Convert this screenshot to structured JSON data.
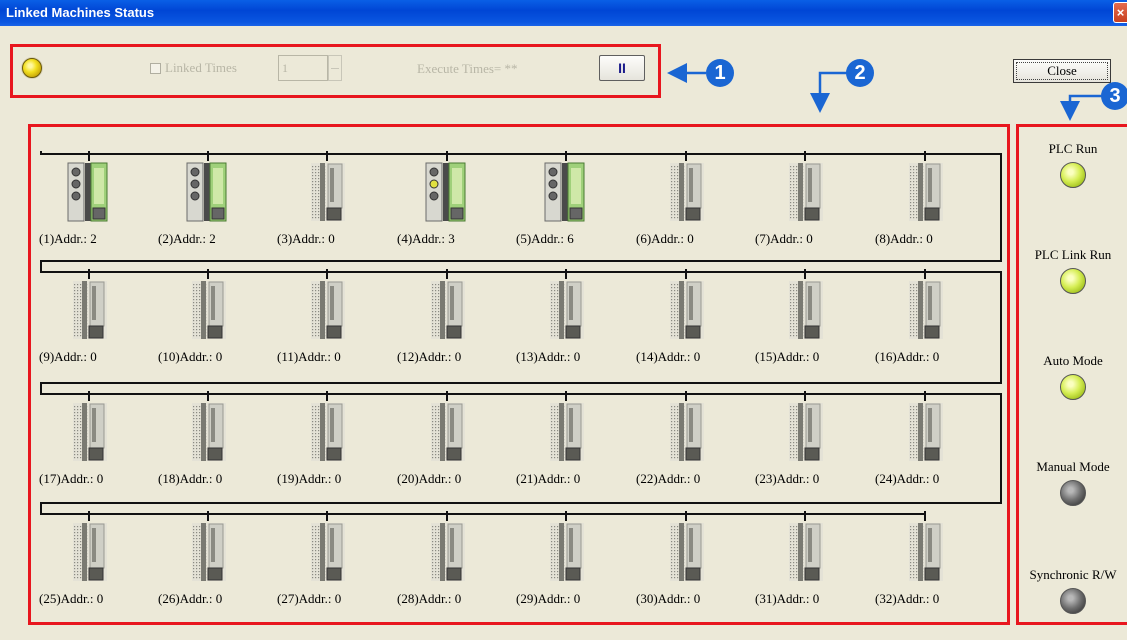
{
  "window": {
    "title": "Linked Machines Status",
    "close_glyph": "×"
  },
  "toolbar": {
    "linked_times_label": "Linked Times",
    "linked_times_value": "1",
    "execute_times_label": "Execute Times= **",
    "pause_label": "II",
    "close_label": "Close"
  },
  "callouts": [
    "1",
    "2",
    "3"
  ],
  "machines": [
    {
      "label": "(1)Addr.: 2",
      "active": true,
      "led": "gray"
    },
    {
      "label": "(2)Addr.: 2",
      "active": true,
      "led": "gray"
    },
    {
      "label": "(3)Addr.: 0",
      "active": false
    },
    {
      "label": "(4)Addr.: 3",
      "active": true,
      "led": "yellow"
    },
    {
      "label": "(5)Addr.: 6",
      "active": true,
      "led": "gray"
    },
    {
      "label": "(6)Addr.: 0",
      "active": false
    },
    {
      "label": "(7)Addr.: 0",
      "active": false
    },
    {
      "label": "(8)Addr.: 0",
      "active": false
    },
    {
      "label": "(9)Addr.: 0",
      "active": false
    },
    {
      "label": "(10)Addr.: 0",
      "active": false
    },
    {
      "label": "(11)Addr.: 0",
      "active": false
    },
    {
      "label": "(12)Addr.: 0",
      "active": false
    },
    {
      "label": "(13)Addr.: 0",
      "active": false
    },
    {
      "label": "(14)Addr.: 0",
      "active": false
    },
    {
      "label": "(15)Addr.: 0",
      "active": false
    },
    {
      "label": "(16)Addr.: 0",
      "active": false
    },
    {
      "label": "(17)Addr.: 0",
      "active": false
    },
    {
      "label": "(18)Addr.: 0",
      "active": false
    },
    {
      "label": "(19)Addr.: 0",
      "active": false
    },
    {
      "label": "(20)Addr.: 0",
      "active": false
    },
    {
      "label": "(21)Addr.: 0",
      "active": false
    },
    {
      "label": "(22)Addr.: 0",
      "active": false
    },
    {
      "label": "(23)Addr.: 0",
      "active": false
    },
    {
      "label": "(24)Addr.: 0",
      "active": false
    },
    {
      "label": "(25)Addr.: 0",
      "active": false
    },
    {
      "label": "(26)Addr.: 0",
      "active": false
    },
    {
      "label": "(27)Addr.: 0",
      "active": false
    },
    {
      "label": "(28)Addr.: 0",
      "active": false
    },
    {
      "label": "(29)Addr.: 0",
      "active": false
    },
    {
      "label": "(30)Addr.: 0",
      "active": false
    },
    {
      "label": "(31)Addr.: 0",
      "active": false
    },
    {
      "label": "(32)Addr.: 0",
      "active": false
    }
  ],
  "indicators": [
    {
      "label": "PLC Run",
      "state": "green"
    },
    {
      "label": "PLC Link Run",
      "state": "green"
    },
    {
      "label": "Auto Mode",
      "state": "green"
    },
    {
      "label": "Manual Mode",
      "state": "gray"
    },
    {
      "label": "Synchronic R/W",
      "state": "gray"
    }
  ],
  "colors": {
    "accent_red": "#e8161e",
    "callout_blue": "#1a66d3",
    "titlebar": "#0046d5"
  }
}
